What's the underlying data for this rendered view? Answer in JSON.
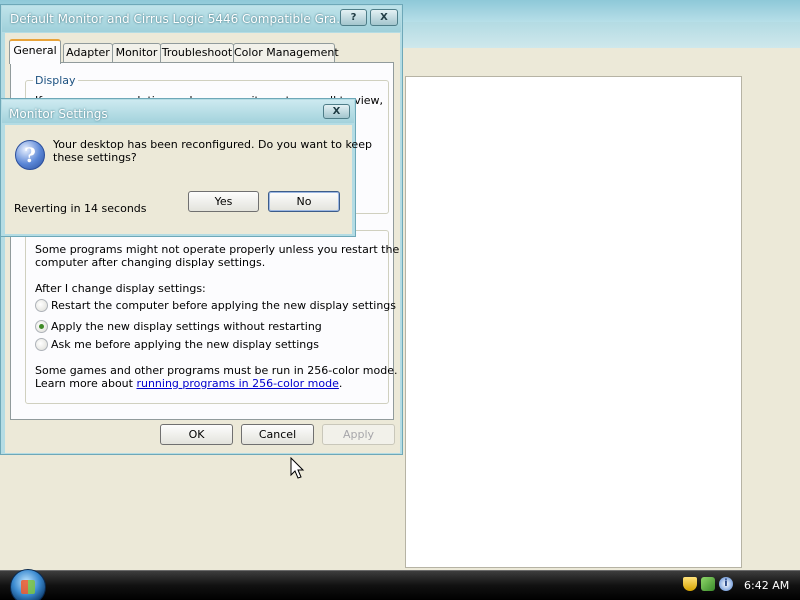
{
  "main_window": {
    "title": "Default Monitor and Cirrus Logic 5446 Compatible Gra...",
    "caption_buttons": {
      "help": "?",
      "close": "X"
    },
    "tabs": [
      {
        "label": "General",
        "active": true
      },
      {
        "label": "Adapter",
        "active": false
      },
      {
        "label": "Monitor",
        "active": false
      },
      {
        "label": "Troubleshoot",
        "active": false
      },
      {
        "label": "Color Management",
        "active": false
      }
    ],
    "display_group": {
      "legend": "Display",
      "partial_text": "If your screen resolution makes screen items too small to view,"
    },
    "compat_group": {
      "intro_line1": "Some programs might not operate properly unless you restart the",
      "intro_line2": "computer after changing display settings.",
      "after_label": "After I change display settings:",
      "options": [
        {
          "label": "Restart the computer before applying the new display settings",
          "checked": false
        },
        {
          "label": "Apply the new display settings without restarting",
          "checked": true
        },
        {
          "label": "Ask me before applying the new display settings",
          "checked": false
        }
      ],
      "games_line1": "Some games and other programs must be run in 256-color mode.",
      "games_line2_prefix": "Learn more about ",
      "games_link": "running programs in 256-color mode",
      "games_line2_suffix": "."
    },
    "buttons": {
      "ok": "OK",
      "cancel": "Cancel",
      "apply": "Apply"
    }
  },
  "dialog": {
    "title": "Monitor Settings",
    "close_glyph": "X",
    "icon": "question-icon",
    "message_line1": "Your desktop has been reconfigured.  Do you want to keep",
    "message_line2": "these settings?",
    "countdown": "Reverting in 14 seconds",
    "yes": "Yes",
    "no": "No"
  },
  "taskbar": {
    "clock": "6:42 AM",
    "tray_icons": [
      "security-shield-icon",
      "network-icon",
      "info-icon"
    ]
  }
}
